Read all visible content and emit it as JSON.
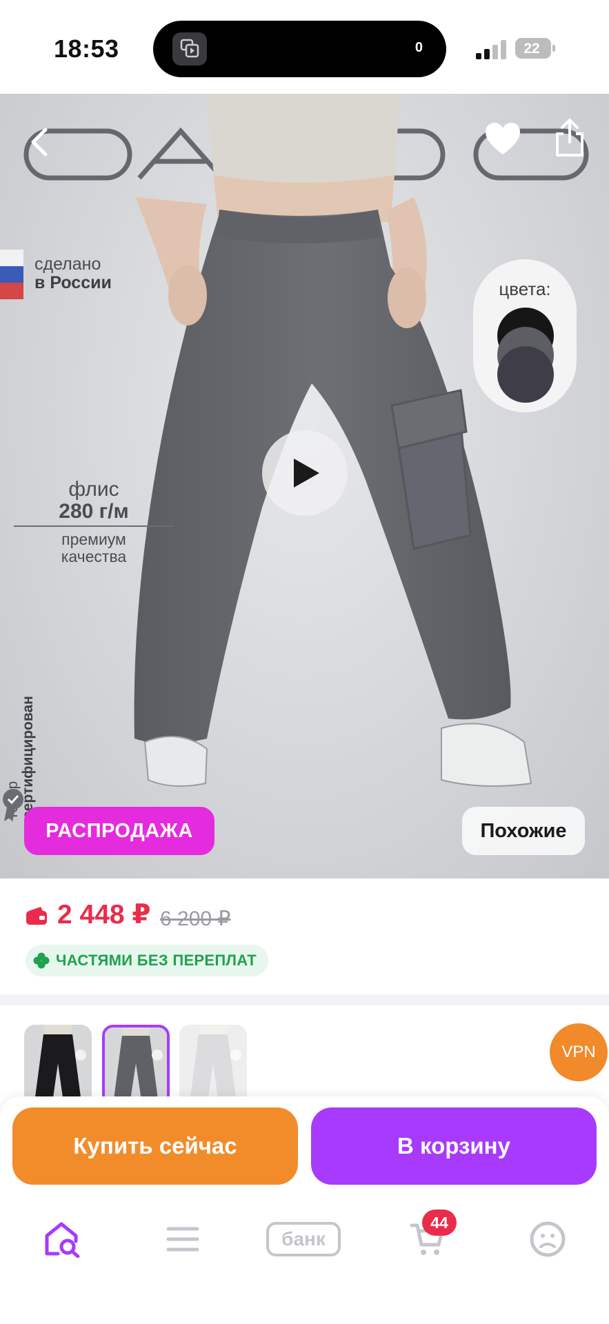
{
  "status_bar": {
    "time": "18:53",
    "island_count": "0",
    "battery": "22"
  },
  "hero": {
    "brand_text": "CARGO",
    "made_in_line1": "сделано",
    "made_in_line2": "в России",
    "colors_label": "цвета:",
    "swatch_colors": [
      "#161616",
      "#5d5e63",
      "#3f3d48"
    ],
    "fleece_line1": "флис",
    "fleece_line2": "280 г/м",
    "fleece_line3": "премиум",
    "fleece_line4": "качества",
    "cert_line1": "товар",
    "cert_line2": "сертифицирован",
    "sale_badge": "РАСПРОДАЖА",
    "similar_button": "Похожие",
    "icons": [
      "chevron-left-icon",
      "heart-icon",
      "share-icon",
      "play-icon"
    ]
  },
  "price": {
    "current": "2 448 ₽",
    "old": "6 200 ₽",
    "installments": "ЧАСТЯМИ БЕЗ ПЕРЕПЛАТ"
  },
  "variants": {
    "selected_index": 1,
    "vpn_label": "VPN"
  },
  "actions": {
    "buy_now": "Купить сейчас",
    "add_to_cart": "В корзину"
  },
  "bottom_nav": {
    "bank_label": "банк",
    "cart_count": "44"
  },
  "colors": {
    "accent_purple": "#a73afd",
    "accent_orange": "#f28c2b",
    "sale_pink": "#e42bde",
    "price_red": "#ea2c4b",
    "installment_green": "#1ea24e"
  }
}
